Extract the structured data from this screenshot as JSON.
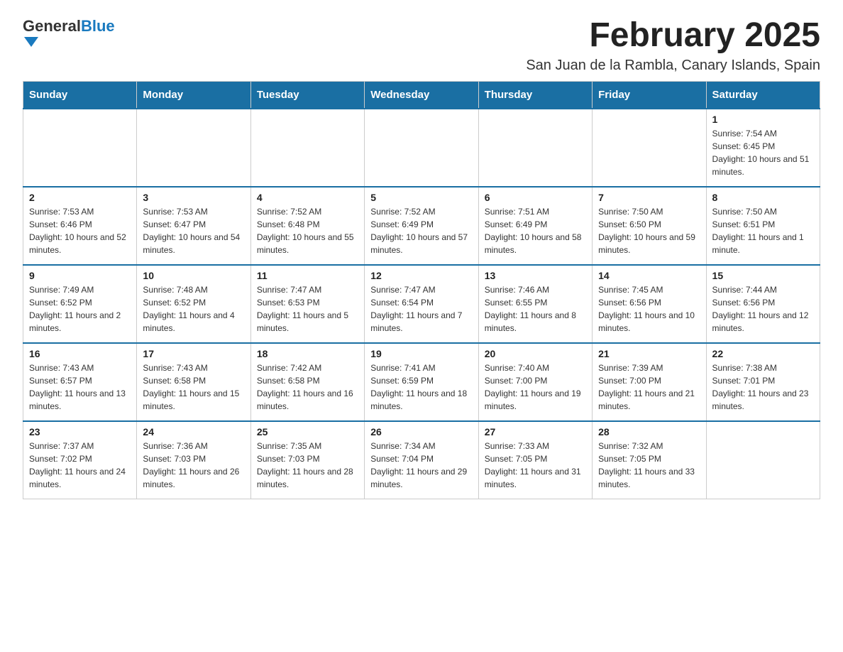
{
  "header": {
    "logo_general": "General",
    "logo_blue": "Blue",
    "month_title": "February 2025",
    "location": "San Juan de la Rambla, Canary Islands, Spain"
  },
  "weekdays": [
    "Sunday",
    "Monday",
    "Tuesday",
    "Wednesday",
    "Thursday",
    "Friday",
    "Saturday"
  ],
  "weeks": [
    [
      {
        "day": "",
        "sunrise": "",
        "sunset": "",
        "daylight": ""
      },
      {
        "day": "",
        "sunrise": "",
        "sunset": "",
        "daylight": ""
      },
      {
        "day": "",
        "sunrise": "",
        "sunset": "",
        "daylight": ""
      },
      {
        "day": "",
        "sunrise": "",
        "sunset": "",
        "daylight": ""
      },
      {
        "day": "",
        "sunrise": "",
        "sunset": "",
        "daylight": ""
      },
      {
        "day": "",
        "sunrise": "",
        "sunset": "",
        "daylight": ""
      },
      {
        "day": "1",
        "sunrise": "Sunrise: 7:54 AM",
        "sunset": "Sunset: 6:45 PM",
        "daylight": "Daylight: 10 hours and 51 minutes."
      }
    ],
    [
      {
        "day": "2",
        "sunrise": "Sunrise: 7:53 AM",
        "sunset": "Sunset: 6:46 PM",
        "daylight": "Daylight: 10 hours and 52 minutes."
      },
      {
        "day": "3",
        "sunrise": "Sunrise: 7:53 AM",
        "sunset": "Sunset: 6:47 PM",
        "daylight": "Daylight: 10 hours and 54 minutes."
      },
      {
        "day": "4",
        "sunrise": "Sunrise: 7:52 AM",
        "sunset": "Sunset: 6:48 PM",
        "daylight": "Daylight: 10 hours and 55 minutes."
      },
      {
        "day": "5",
        "sunrise": "Sunrise: 7:52 AM",
        "sunset": "Sunset: 6:49 PM",
        "daylight": "Daylight: 10 hours and 57 minutes."
      },
      {
        "day": "6",
        "sunrise": "Sunrise: 7:51 AM",
        "sunset": "Sunset: 6:49 PM",
        "daylight": "Daylight: 10 hours and 58 minutes."
      },
      {
        "day": "7",
        "sunrise": "Sunrise: 7:50 AM",
        "sunset": "Sunset: 6:50 PM",
        "daylight": "Daylight: 10 hours and 59 minutes."
      },
      {
        "day": "8",
        "sunrise": "Sunrise: 7:50 AM",
        "sunset": "Sunset: 6:51 PM",
        "daylight": "Daylight: 11 hours and 1 minute."
      }
    ],
    [
      {
        "day": "9",
        "sunrise": "Sunrise: 7:49 AM",
        "sunset": "Sunset: 6:52 PM",
        "daylight": "Daylight: 11 hours and 2 minutes."
      },
      {
        "day": "10",
        "sunrise": "Sunrise: 7:48 AM",
        "sunset": "Sunset: 6:52 PM",
        "daylight": "Daylight: 11 hours and 4 minutes."
      },
      {
        "day": "11",
        "sunrise": "Sunrise: 7:47 AM",
        "sunset": "Sunset: 6:53 PM",
        "daylight": "Daylight: 11 hours and 5 minutes."
      },
      {
        "day": "12",
        "sunrise": "Sunrise: 7:47 AM",
        "sunset": "Sunset: 6:54 PM",
        "daylight": "Daylight: 11 hours and 7 minutes."
      },
      {
        "day": "13",
        "sunrise": "Sunrise: 7:46 AM",
        "sunset": "Sunset: 6:55 PM",
        "daylight": "Daylight: 11 hours and 8 minutes."
      },
      {
        "day": "14",
        "sunrise": "Sunrise: 7:45 AM",
        "sunset": "Sunset: 6:56 PM",
        "daylight": "Daylight: 11 hours and 10 minutes."
      },
      {
        "day": "15",
        "sunrise": "Sunrise: 7:44 AM",
        "sunset": "Sunset: 6:56 PM",
        "daylight": "Daylight: 11 hours and 12 minutes."
      }
    ],
    [
      {
        "day": "16",
        "sunrise": "Sunrise: 7:43 AM",
        "sunset": "Sunset: 6:57 PM",
        "daylight": "Daylight: 11 hours and 13 minutes."
      },
      {
        "day": "17",
        "sunrise": "Sunrise: 7:43 AM",
        "sunset": "Sunset: 6:58 PM",
        "daylight": "Daylight: 11 hours and 15 minutes."
      },
      {
        "day": "18",
        "sunrise": "Sunrise: 7:42 AM",
        "sunset": "Sunset: 6:58 PM",
        "daylight": "Daylight: 11 hours and 16 minutes."
      },
      {
        "day": "19",
        "sunrise": "Sunrise: 7:41 AM",
        "sunset": "Sunset: 6:59 PM",
        "daylight": "Daylight: 11 hours and 18 minutes."
      },
      {
        "day": "20",
        "sunrise": "Sunrise: 7:40 AM",
        "sunset": "Sunset: 7:00 PM",
        "daylight": "Daylight: 11 hours and 19 minutes."
      },
      {
        "day": "21",
        "sunrise": "Sunrise: 7:39 AM",
        "sunset": "Sunset: 7:00 PM",
        "daylight": "Daylight: 11 hours and 21 minutes."
      },
      {
        "day": "22",
        "sunrise": "Sunrise: 7:38 AM",
        "sunset": "Sunset: 7:01 PM",
        "daylight": "Daylight: 11 hours and 23 minutes."
      }
    ],
    [
      {
        "day": "23",
        "sunrise": "Sunrise: 7:37 AM",
        "sunset": "Sunset: 7:02 PM",
        "daylight": "Daylight: 11 hours and 24 minutes."
      },
      {
        "day": "24",
        "sunrise": "Sunrise: 7:36 AM",
        "sunset": "Sunset: 7:03 PM",
        "daylight": "Daylight: 11 hours and 26 minutes."
      },
      {
        "day": "25",
        "sunrise": "Sunrise: 7:35 AM",
        "sunset": "Sunset: 7:03 PM",
        "daylight": "Daylight: 11 hours and 28 minutes."
      },
      {
        "day": "26",
        "sunrise": "Sunrise: 7:34 AM",
        "sunset": "Sunset: 7:04 PM",
        "daylight": "Daylight: 11 hours and 29 minutes."
      },
      {
        "day": "27",
        "sunrise": "Sunrise: 7:33 AM",
        "sunset": "Sunset: 7:05 PM",
        "daylight": "Daylight: 11 hours and 31 minutes."
      },
      {
        "day": "28",
        "sunrise": "Sunrise: 7:32 AM",
        "sunset": "Sunset: 7:05 PM",
        "daylight": "Daylight: 11 hours and 33 minutes."
      },
      {
        "day": "",
        "sunrise": "",
        "sunset": "",
        "daylight": ""
      }
    ]
  ]
}
